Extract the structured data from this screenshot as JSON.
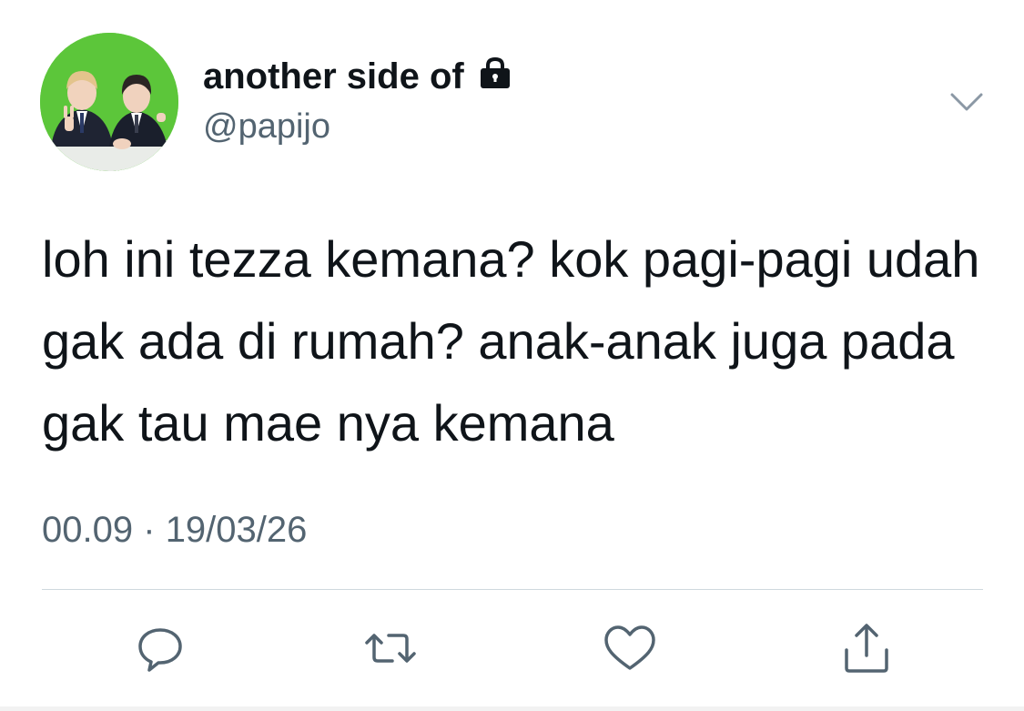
{
  "tweet": {
    "display_name": "another side of",
    "handle": "@papijo",
    "text": "loh ini tezza kemana? kok pagi-pagi udah gak ada di rumah? anak-anak juga pada gak tau mae nya kemana",
    "time": "00.09",
    "separator": "·",
    "date": "19/03/26"
  },
  "icons": {
    "lock": "lock-icon",
    "menu": "chevron-down-icon",
    "reply": "reply-icon",
    "retweet": "retweet-icon",
    "like": "heart-icon",
    "share": "share-icon"
  },
  "colors": {
    "text": "#0f1419",
    "secondary": "#536471",
    "icon": "#536471",
    "divider": "#cfd9de",
    "avatar_bg": "#5cc63a"
  }
}
